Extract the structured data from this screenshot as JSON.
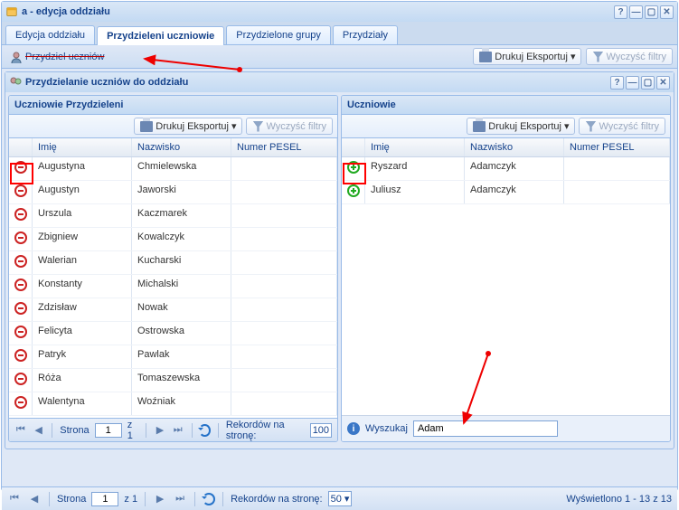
{
  "window": {
    "title": "a - edycja oddziału"
  },
  "tabs": {
    "edit": "Edycja oddziału",
    "assigned_students": "Przydzieleni uczniowie",
    "assigned_groups": "Przydzielone grupy",
    "assignments": "Przydziały"
  },
  "toolbar": {
    "assign_students": "Przydziel uczniów",
    "print_export": "Drukuj Eksportuj",
    "clear_filters": "Wyczyść filtry"
  },
  "assign_window": {
    "title": "Przydzielanie uczniów do oddziału"
  },
  "panel_assigned": {
    "title": "Uczniowie Przydzieleni",
    "print_export": "Drukuj Eksportuj",
    "clear_filters": "Wyczyść filtry"
  },
  "panel_available": {
    "title": "Uczniowie",
    "print_export": "Drukuj Eksportuj",
    "clear_filters": "Wyczyść filtry"
  },
  "columns": {
    "first_name": "Imię",
    "last_name": "Nazwisko",
    "pesel": "Numer PESEL"
  },
  "assigned_rows": [
    {
      "first": "Augustyna",
      "last": "Chmielewska"
    },
    {
      "first": "Augustyn",
      "last": "Jaworski"
    },
    {
      "first": "Urszula",
      "last": "Kaczmarek"
    },
    {
      "first": "Zbigniew",
      "last": "Kowalczyk"
    },
    {
      "first": "Walerian",
      "last": "Kucharski"
    },
    {
      "first": "Konstanty",
      "last": "Michalski"
    },
    {
      "first": "Zdzisław",
      "last": "Nowak"
    },
    {
      "first": "Felicyta",
      "last": "Ostrowska"
    },
    {
      "first": "Patryk",
      "last": "Pawlak"
    },
    {
      "first": "Róża",
      "last": "Tomaszewska"
    },
    {
      "first": "Walentyna",
      "last": "Woźniak"
    }
  ],
  "available_rows": [
    {
      "first": "Ryszard",
      "last": "Adamczyk"
    },
    {
      "first": "Juliusz",
      "last": "Adamczyk"
    }
  ],
  "search": {
    "label": "Wyszukaj",
    "value": "Adam"
  },
  "pager": {
    "page_label": "Strona",
    "of_label": "z 1",
    "page_num": "1",
    "records_label": "Rekordów na stronę:",
    "per_page_100": "100",
    "per_page_50": "50",
    "display_text": "Wyświetlono 1 - 13 z 13"
  }
}
